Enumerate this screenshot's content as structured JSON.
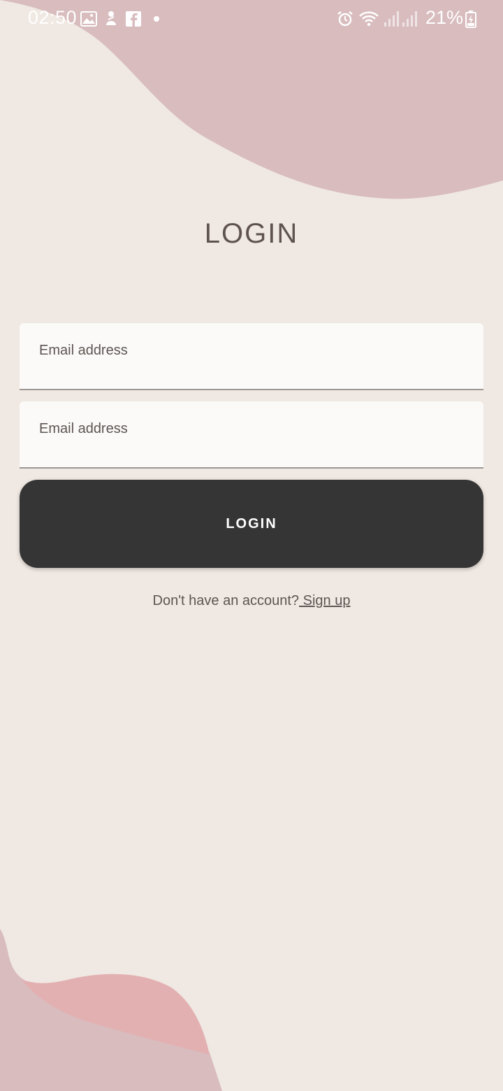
{
  "status_bar": {
    "time": "02:50",
    "battery_percent": "21%",
    "left_icons": [
      "image-icon",
      "notification-figure-icon",
      "facebook-icon",
      "dot-icon"
    ],
    "right_icons": [
      "alarm-icon",
      "wifi-icon",
      "signal-icon",
      "signal-icon",
      "battery-charging-icon"
    ]
  },
  "page": {
    "title": "LOGIN"
  },
  "form": {
    "email_placeholder": "Email address",
    "password_placeholder": "Email address",
    "login_button_label": "LOGIN"
  },
  "signup": {
    "prompt": "Don't have an account?",
    "link_label": " Sign up"
  },
  "colors": {
    "background": "#f0e8e2",
    "blob_top": "#d8bcbe",
    "blob_bottom_back": "#d8bcbe",
    "blob_bottom_front": "#e3b0b2",
    "button": "#353535"
  }
}
